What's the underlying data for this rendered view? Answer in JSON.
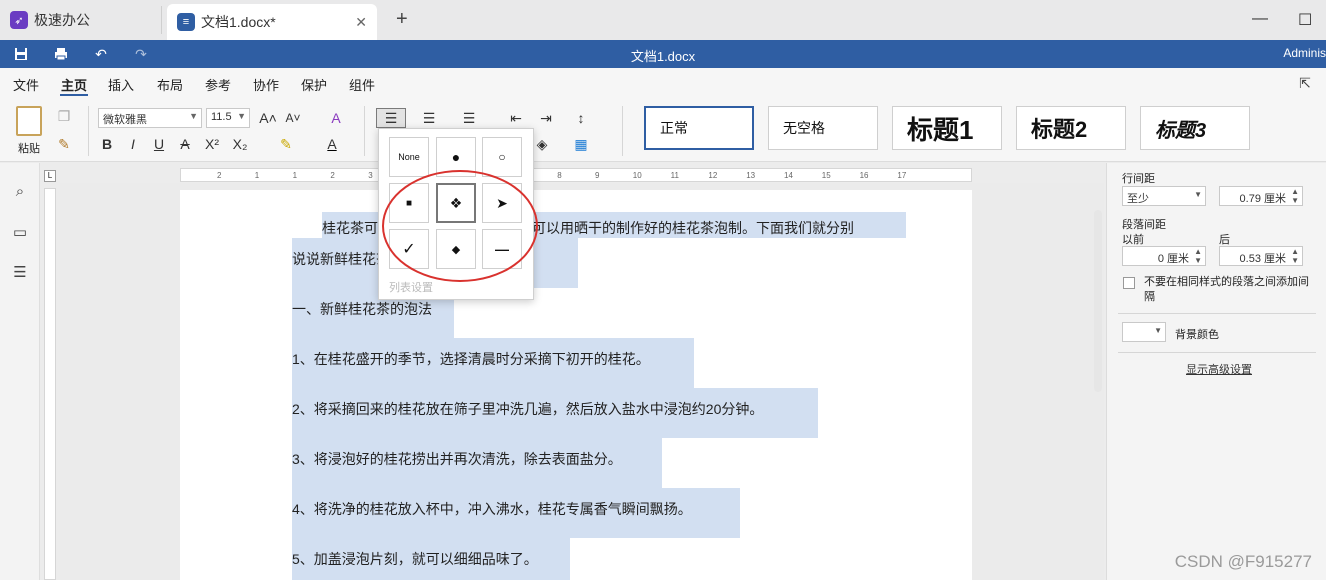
{
  "tabs": [
    {
      "label": "极速办公",
      "icon": "rocket-icon",
      "color": "#6a3cc2"
    },
    {
      "label": "文档1.docx*",
      "icon": "document-icon",
      "color": "#2f5ea3"
    }
  ],
  "titlebar": {
    "doc_title": "文档1.docx",
    "user": "Adminis"
  },
  "menu": [
    "文件",
    "主页",
    "插入",
    "布局",
    "参考",
    "协作",
    "保护",
    "组件"
  ],
  "ribbon": {
    "paste_label": "粘贴",
    "font_name": "微软雅黑",
    "font_size": "11.5",
    "styles": [
      "正常",
      "无空格",
      "标题1",
      "标题2",
      "标题3"
    ]
  },
  "bullet_menu": {
    "cells": [
      "None",
      "●",
      "○",
      "■",
      "❖",
      "➤",
      "✓",
      "◆",
      "—"
    ],
    "footer": "列表设置"
  },
  "ruler_numbers": [
    "2",
    "1",
    "1",
    "2",
    "3",
    "4",
    "5",
    "6",
    "7",
    "8",
    "9",
    "10",
    "11",
    "12",
    "13",
    "14",
    "15",
    "16",
    "17"
  ],
  "document": {
    "lines": [
      "桂花茶可以用新鲜的桂花冲泡，也可以用晒干的制作好的桂花茶泡制。下面我们就分别",
      "说说新鲜桂花茶和干桂花茶的冲泡。",
      "一、新鲜桂花茶的泡法",
      "1、在桂花盛开的季节，选择清晨时分采摘下初开的桂花。",
      "2、将采摘回来的桂花放在筛子里冲洗几遍，然后放入盐水中浸泡约20分钟。",
      "3、将浸泡好的桂花捞出并再次清洗，除去表面盐分。",
      "4、将洗净的桂花放入杯中，冲入沸水，桂花专属香气瞬间飘扬。",
      "5、加盖浸泡片刻，就可以细细品味了。"
    ]
  },
  "right_panel": {
    "line_spacing_label": "行间距",
    "line_spacing_mode": "至少",
    "line_spacing_value": "0.79 厘米",
    "para_spacing_label": "段落间距",
    "before_label": "以前",
    "after_label": "后",
    "before_value": "0 厘米",
    "after_value": "0.53 厘米",
    "checkbox_label": "不要在相同样式的段落之间添加间隔",
    "bg_color_label": "背景颜色",
    "advanced_link": "显示高级设置"
  },
  "watermark": "CSDN @F915277"
}
